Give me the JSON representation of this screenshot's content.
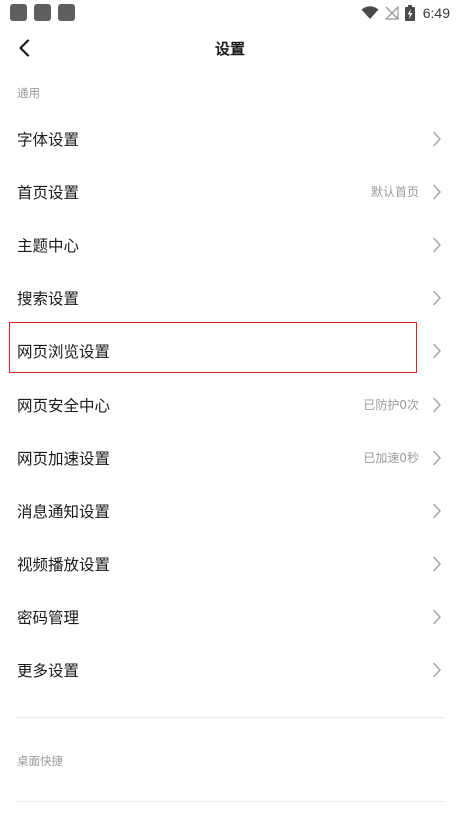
{
  "status_bar": {
    "time": "6:49",
    "icons": [
      "app-notification-icon",
      "app-notification-icon",
      "app-notification-icon",
      "wifi-icon",
      "no-signal-icon",
      "battery-charging-icon"
    ]
  },
  "header": {
    "back_icon": "chevron-left-icon",
    "title": "设置"
  },
  "sections": {
    "general_label": "通用",
    "desktop_shortcut_label": "桌面快捷"
  },
  "settings_items": [
    {
      "label": "字体设置",
      "value": ""
    },
    {
      "label": "首页设置",
      "value": "默认首页"
    },
    {
      "label": "主题中心",
      "value": ""
    },
    {
      "label": "搜索设置",
      "value": ""
    },
    {
      "label": "网页浏览设置",
      "value": ""
    },
    {
      "label": "网页安全中心",
      "value": "已防护0次"
    },
    {
      "label": "网页加速设置",
      "value": "已加速0秒"
    },
    {
      "label": "消息通知设置",
      "value": ""
    },
    {
      "label": "视频播放设置",
      "value": ""
    },
    {
      "label": "密码管理",
      "value": ""
    },
    {
      "label": "更多设置",
      "value": ""
    }
  ],
  "colors": {
    "highlight_border": "#e02020",
    "secondary_text": "#9a9a9a",
    "divider": "#ececec"
  }
}
